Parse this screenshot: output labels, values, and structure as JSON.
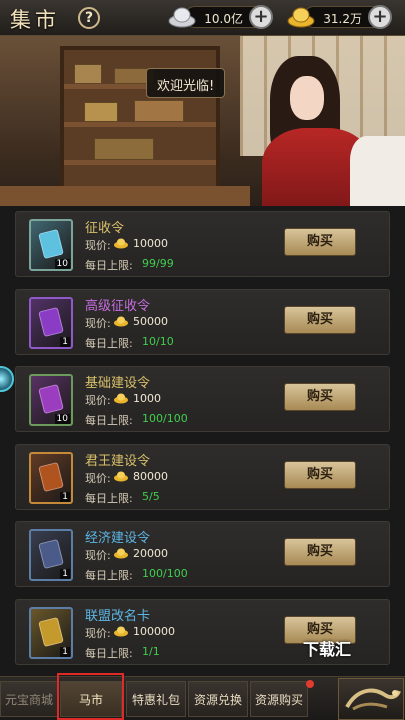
{
  "header": {
    "title": "集市",
    "help_label": "?",
    "silver_amount": "10.0亿",
    "gold_amount": "31.2万",
    "plus_label": "+"
  },
  "banner": {
    "welcome_text": "欢迎光临!"
  },
  "colors": {
    "limit_text": "#3fcf4d",
    "buy_button": "#c8b082",
    "highlight": "#e02a2a"
  },
  "items": [
    {
      "name": "征收令",
      "name_color": "#d8c06a",
      "price_label": "现价:",
      "price": "10000",
      "limit_label": "每日上限:",
      "limit": "99/99",
      "count": "10",
      "buy_label": "购买",
      "icon_color": "#5ec1e0",
      "frame": "#7ca59a",
      "icon": "scroll-icon"
    },
    {
      "name": "高级征收令",
      "name_color": "#c66de0",
      "price_label": "现价:",
      "price": "50000",
      "limit_label": "每日上限:",
      "limit": "10/10",
      "count": "1",
      "buy_label": "购买",
      "icon_color": "#8a3cc5",
      "frame": "#8f59c9",
      "icon": "scroll-icon"
    },
    {
      "name": "基础建设令",
      "name_color": "#d8c06a",
      "price_label": "现价:",
      "price": "1000",
      "limit_label": "每日上限:",
      "limit": "100/100",
      "count": "10",
      "buy_label": "购买",
      "icon_color": "#9b3dbf",
      "frame": "#6c9a5b",
      "icon": "scroll-icon"
    },
    {
      "name": "君王建设令",
      "name_color": "#d8c06a",
      "price_label": "现价:",
      "price": "80000",
      "limit_label": "每日上限:",
      "limit": "5/5",
      "count": "1",
      "buy_label": "购买",
      "icon_color": "#b0541f",
      "frame": "#c48a3a",
      "icon": "scroll-icon"
    },
    {
      "name": "经济建设令",
      "name_color": "#5cb7e6",
      "price_label": "现价:",
      "price": "20000",
      "limit_label": "每日上限:",
      "limit": "100/100",
      "count": "1",
      "buy_label": "购买",
      "icon_color": "#4a5b8a",
      "frame": "#5c7ea6",
      "icon": "scroll-icon"
    },
    {
      "name": "联盟改名卡",
      "name_color": "#5cb7e6",
      "price_label": "现价:",
      "price": "100000",
      "limit_label": "每日上限:",
      "limit": "1/1",
      "count": "1",
      "buy_label": "购买",
      "icon_color": "#c59a2c",
      "frame": "#5c7ea6",
      "icon": "card-icon"
    }
  ],
  "watermark": "下载汇",
  "tabs": [
    {
      "label": "元宝商城",
      "state": "dim"
    },
    {
      "label": "马市",
      "state": "active"
    },
    {
      "label": "特惠礼包",
      "state": "normal"
    },
    {
      "label": "资源兑换",
      "state": "normal"
    },
    {
      "label": "资源购买",
      "state": "normal"
    }
  ]
}
